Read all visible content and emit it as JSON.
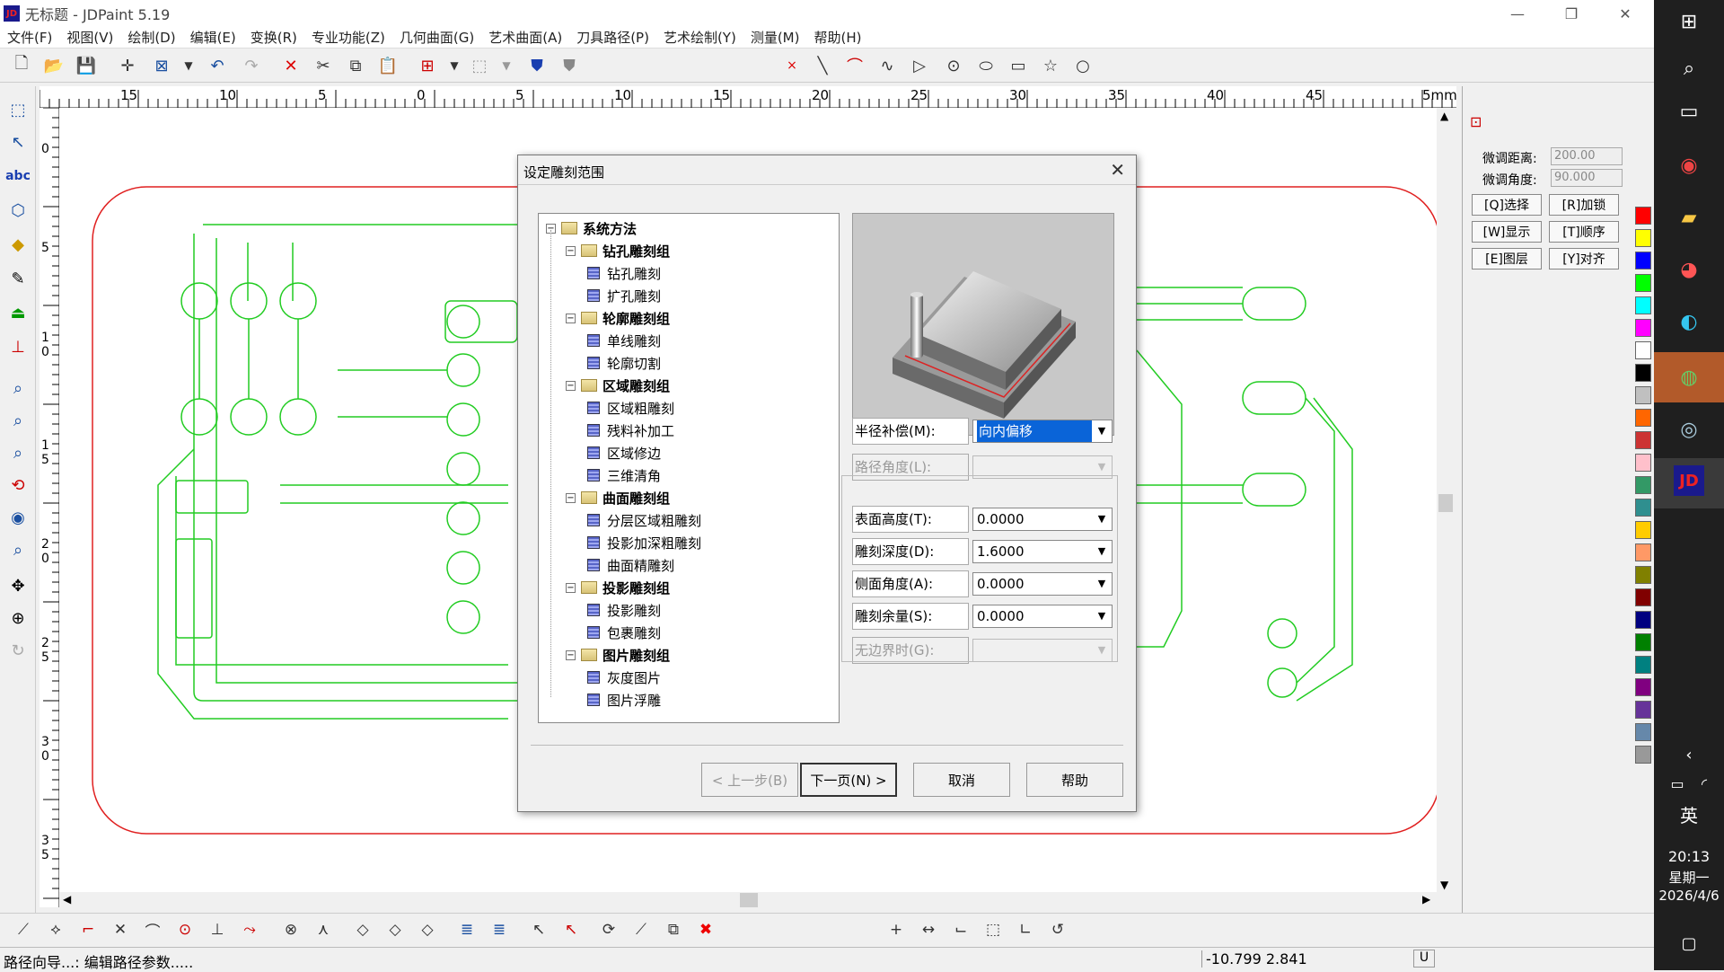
{
  "window": {
    "title": "无标题 - JDPaint 5.19",
    "logo": "JD"
  },
  "menu": [
    "文件(F)",
    "视图(V)",
    "绘制(D)",
    "编辑(E)",
    "变换(R)",
    "专业功能(Z)",
    "几何曲面(G)",
    "艺术曲面(A)",
    "刀具路径(P)",
    "艺术绘制(Y)",
    "测量(M)",
    "帮助(H)"
  ],
  "ruler": {
    "h_labels": [
      "15",
      "10",
      "5",
      "0",
      "5",
      "10",
      "15",
      "20",
      "25",
      "30",
      "35",
      "40",
      "45",
      "5mm"
    ],
    "v_labels": [
      "0",
      "5",
      "1\n0",
      "1\n5",
      "2\n0",
      "2\n5",
      "3\n0",
      "3\n5"
    ]
  },
  "right_panel": {
    "fine_distance_label": "微调距离:",
    "fine_distance_value": "200.00",
    "fine_angle_label": "微调角度:",
    "fine_angle_value": "90.000",
    "buttons": [
      "[Q]选择",
      "[R]加锁",
      "[W]显示",
      "[T]顺序",
      "[E]图层",
      "[Y]对齐"
    ]
  },
  "palette": [
    "#ff0000",
    "#ffff00",
    "#0000ff",
    "#00ff00",
    "#00ffff",
    "#ff00ff",
    "#ffffff",
    "#000000",
    "#c0c0c0",
    "#ff6600",
    "#cc3333",
    "#ffc0cb",
    "#339966",
    "#2f8f8f",
    "#ffcc00",
    "#ff9966",
    "#808000",
    "#800000",
    "#000080",
    "#008000",
    "#008080",
    "#800080",
    "#663399",
    "#6688aa",
    "#999999"
  ],
  "dialog": {
    "title": "设定雕刻范围",
    "tree": [
      {
        "label": "系统方法",
        "level": 0,
        "type": "folder",
        "bold": true
      },
      {
        "label": "钻孔雕刻组",
        "level": 1,
        "type": "folder",
        "bold": true
      },
      {
        "label": "钻孔雕刻",
        "level": 2,
        "type": "page"
      },
      {
        "label": "扩孔雕刻",
        "level": 2,
        "type": "page"
      },
      {
        "label": "轮廓雕刻组",
        "level": 1,
        "type": "folder",
        "bold": true
      },
      {
        "label": "单线雕刻",
        "level": 2,
        "type": "page"
      },
      {
        "label": "轮廓切割",
        "level": 2,
        "type": "page"
      },
      {
        "label": "区域雕刻组",
        "level": 1,
        "type": "folder",
        "bold": true
      },
      {
        "label": "区域粗雕刻",
        "level": 2,
        "type": "page"
      },
      {
        "label": "残料补加工",
        "level": 2,
        "type": "page"
      },
      {
        "label": "区域修边",
        "level": 2,
        "type": "page"
      },
      {
        "label": "三维清角",
        "level": 2,
        "type": "page"
      },
      {
        "label": "曲面雕刻组",
        "level": 1,
        "type": "folder",
        "bold": true
      },
      {
        "label": "分层区域粗雕刻",
        "level": 2,
        "type": "page"
      },
      {
        "label": "投影加深粗雕刻",
        "level": 2,
        "type": "page"
      },
      {
        "label": "曲面精雕刻",
        "level": 2,
        "type": "page"
      },
      {
        "label": "投影雕刻组",
        "level": 1,
        "type": "folder",
        "bold": true
      },
      {
        "label": "投影雕刻",
        "level": 2,
        "type": "page"
      },
      {
        "label": "包裹雕刻",
        "level": 2,
        "type": "page"
      },
      {
        "label": "图片雕刻组",
        "level": 1,
        "type": "folder",
        "bold": true
      },
      {
        "label": "灰度图片",
        "level": 2,
        "type": "page"
      },
      {
        "label": "图片浮雕",
        "level": 2,
        "type": "page"
      }
    ],
    "fields": [
      {
        "label": "半径补偿(M):",
        "value": "向内偏移",
        "selected": true,
        "disabled": false
      },
      {
        "label": "路径角度(L):",
        "value": "",
        "disabled": true
      },
      {
        "label": "表面高度(T):",
        "value": "0.0000",
        "disabled": false
      },
      {
        "label": "雕刻深度(D):",
        "value": "1.6000",
        "disabled": false
      },
      {
        "label": "侧面角度(A):",
        "value": "0.0000",
        "disabled": false
      },
      {
        "label": "雕刻余量(S):",
        "value": "0.0000",
        "disabled": false
      },
      {
        "label": "无边界时(G):",
        "value": "",
        "disabled": true
      }
    ],
    "buttons": {
      "prev": "< 上一步(B)",
      "next": "下一页(N) >",
      "cancel": "取消",
      "help": "帮助"
    }
  },
  "status": {
    "text": "路径向导...: 编辑路径参数.....",
    "coords": "-10.799 2.841",
    "unit": "U"
  },
  "taskbar": {
    "ime": "英",
    "time": "20:13",
    "weekday": "星期一",
    "date": "2026/4/6"
  }
}
